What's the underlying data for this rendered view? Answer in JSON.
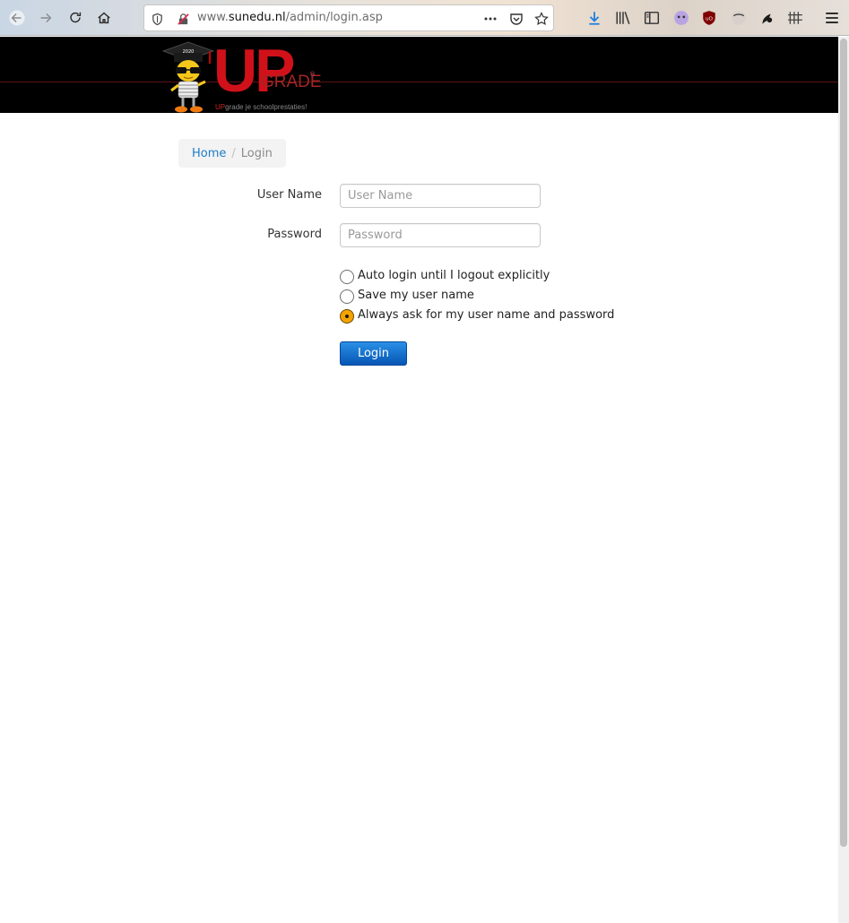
{
  "browser": {
    "url_prefix": "www.",
    "url_domain": "sunedu.nl",
    "url_path": "/admin/login.asp",
    "icons": [
      "back-icon",
      "forward-icon",
      "reload-icon",
      "home-icon",
      "shield-icon",
      "insecure-lock-icon",
      "more-icon",
      "pocket-icon",
      "bookmark-star-icon",
      "download-icon",
      "library-icon",
      "sidebar-icon",
      "extension-icon",
      "ublock-icon",
      "menu-icon"
    ]
  },
  "header": {
    "logo_word": "UP",
    "logo_sub": "GRADE",
    "logo_reg": "®",
    "logo_tag_prefix": "UP",
    "logo_tag_rest": "grade je schoolprestaties!",
    "logo_hat_text": "2020"
  },
  "breadcrumb": {
    "home": "Home",
    "separator": "/",
    "current": "Login"
  },
  "form": {
    "username_label": "User Name",
    "username_placeholder": "User Name",
    "username_value": "",
    "password_label": "Password",
    "password_placeholder": "Password",
    "password_value": "",
    "options": [
      {
        "label": "Auto login until I logout explicitly",
        "checked": false
      },
      {
        "label": "Save my user name",
        "checked": false
      },
      {
        "label": "Always ask for my user name and password",
        "checked": true
      }
    ],
    "submit_label": "Login"
  },
  "colors": {
    "accent_link": "#1e7cc8",
    "button_blue": "#0756b4",
    "radio_checked": "#f6a300",
    "brand_red": "#d0111a"
  }
}
